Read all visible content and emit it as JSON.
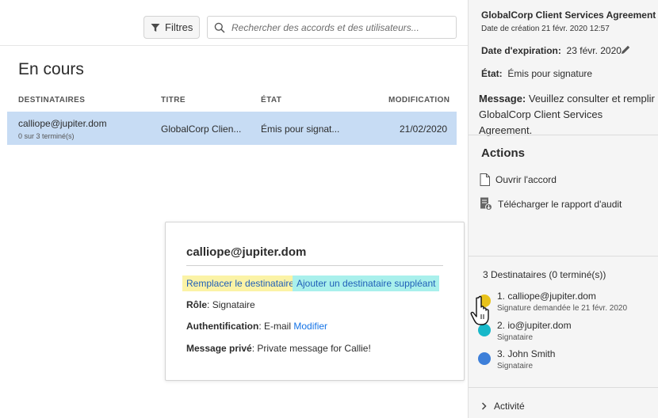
{
  "toolbar": {
    "filter_label": "Filtres",
    "search_placeholder": "Rechercher des accords et des utilisateurs..."
  },
  "list": {
    "section_title": "En cours",
    "columns": [
      "DESTINATAIRES",
      "TITRE",
      "ÉTAT",
      "MODIFICATION"
    ],
    "rows": [
      {
        "recipient": "calliope@jupiter.dom",
        "progress": "0 sur 3 terminé(s)",
        "title": "GlobalCorp Clien...",
        "state": "Émis pour signat...",
        "modified": "21/02/2020"
      }
    ]
  },
  "popover": {
    "email": "calliope@jupiter.dom",
    "replace_label": "Remplacer le destinataire",
    "add_label": "Ajouter un destinataire suppléant",
    "role_label": "Rôle",
    "role_value": "Signataire",
    "auth_label": "Authentification",
    "auth_value": "E-mail",
    "auth_link": "Modifier",
    "private_label": "Message privé",
    "private_value": "Private message for Callie!"
  },
  "details": {
    "title": "GlobalCorp Client Services Agreement",
    "created": "Date de création 21 févr. 2020 12:57",
    "expiration_label": "Date d'expiration:",
    "expiration_value": "23 févr. 2020",
    "state_label": "État:",
    "state_value": "Émis pour signature",
    "message_label": "Message:",
    "message_value": "Veuillez consulter et remplir GlobalCorp Client Services Agreement.",
    "actions_title": "Actions",
    "actions": [
      {
        "label": "Ouvrir l'accord",
        "icon": "document-icon"
      },
      {
        "label": "Télécharger le rapport d'audit",
        "icon": "audit-report-download-icon"
      }
    ],
    "recipients_count": "3 Destinataires (0 terminé(s))",
    "recipients": [
      {
        "name": "1. calliope@jupiter.dom",
        "role": "Signature demandée le 21 févr. 2020",
        "color": "#e8c21a"
      },
      {
        "name": "2. io@jupiter.dom",
        "role": "Signataire",
        "color": "#17b8c9"
      },
      {
        "name": "3. John Smith",
        "role": "Signataire",
        "color": "#3d7fd9"
      }
    ],
    "activity_label": "Activité"
  },
  "colors": {
    "row_selected": "#c7dcf4",
    "link": "#1473e6",
    "highlight_yellow": "#fbf3a6",
    "highlight_cyan": "#a9f0ec"
  }
}
